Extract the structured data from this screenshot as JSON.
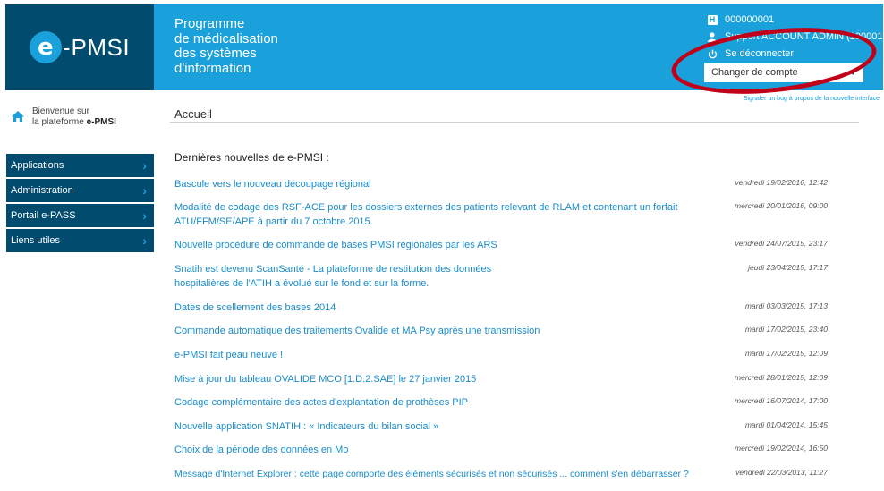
{
  "logo": {
    "letter": "e",
    "dash": "-",
    "text": "PMSI"
  },
  "header": {
    "title_lines": [
      "Programme",
      "de médicalisation",
      "des systèmes",
      "d'information"
    ]
  },
  "user": {
    "etab_code": "000000001",
    "user_name": "Support ACCOUNT ADMIN (100001)",
    "logout_label": "Se déconnecter",
    "change_account_label": "Changer de compte"
  },
  "sidebar": {
    "welcome_line1": "Bienvenue sur",
    "welcome_line2_prefix": "la plateforme ",
    "welcome_line2_bold": "e-PMSI",
    "items": [
      {
        "label": "Applications"
      },
      {
        "label": "Administration"
      },
      {
        "label": "Portail e-PASS"
      },
      {
        "label": "Liens utiles"
      }
    ]
  },
  "main": {
    "signal_link": "Signaler un bug à propos de la nouvelle interface",
    "page_title": "Accueil",
    "news_heading": "Dernières nouvelles de e-PMSI :",
    "news": [
      {
        "title": "Bascule vers le nouveau découpage régional",
        "date": "vendredi 19/02/2016, 12:42"
      },
      {
        "title": "Modalité de codage des RSF-ACE pour les dossiers externes des patients relevant de RLAM et contenant un forfait ATU/FFM/SE/APE à partir du 7 octobre 2015.",
        "date": "mercredi 20/01/2016, 09:00"
      },
      {
        "title": "Nouvelle procédure de commande de bases PMSI régionales par les ARS",
        "date": "vendredi 24/07/2015, 23:17"
      },
      {
        "title": "Snatih est devenu ScanSanté - La plateforme de restitution des données hospitalières de l'ATIH a évolué sur le fond et sur la forme.",
        "date": "jeudi 23/04/2015, 17:17"
      },
      {
        "title": "Dates de scellement des bases 2014",
        "date": "mardi 03/03/2015, 17:13"
      },
      {
        "title": "Commande automatique des traitements Ovalide et MA Psy après une transmission",
        "date": "mardi 17/02/2015, 23:40"
      },
      {
        "title": "e-PMSI fait peau neuve !",
        "date": "mardi 17/02/2015, 12:09"
      },
      {
        "title": "Mise à jour du tableau OVALIDE MCO [1.D.2.SAE] le 27 janvier 2015",
        "date": "mercredi 28/01/2015, 12:09"
      },
      {
        "title": "Codage complémentaire des actes d'explantation de prothèses PIP",
        "date": "mercredi 16/07/2014, 17:00"
      },
      {
        "title": "Nouvelle application SNATIH : « Indicateurs du bilan social »",
        "date": "mardi 01/04/2014, 15:45"
      },
      {
        "title": "Choix de la période des données en Mo",
        "date": "mercredi 19/02/2014, 16:50"
      },
      {
        "title": "Message d'Internet Explorer : cette page comporte des éléments sécurisés et non sécurisés ... comment s'en débarrasser ?",
        "date": "vendredi 22/03/2013, 11:27"
      }
    ]
  },
  "colors": {
    "dark_blue": "#004b6e",
    "light_blue": "#1aa0da",
    "link": "#1a8cc8",
    "annotation_red": "#c00018"
  },
  "icons": [
    "h-icon",
    "user-icon",
    "power-icon",
    "home-icon",
    "chevron-right-icon",
    "caret-down-icon"
  ]
}
